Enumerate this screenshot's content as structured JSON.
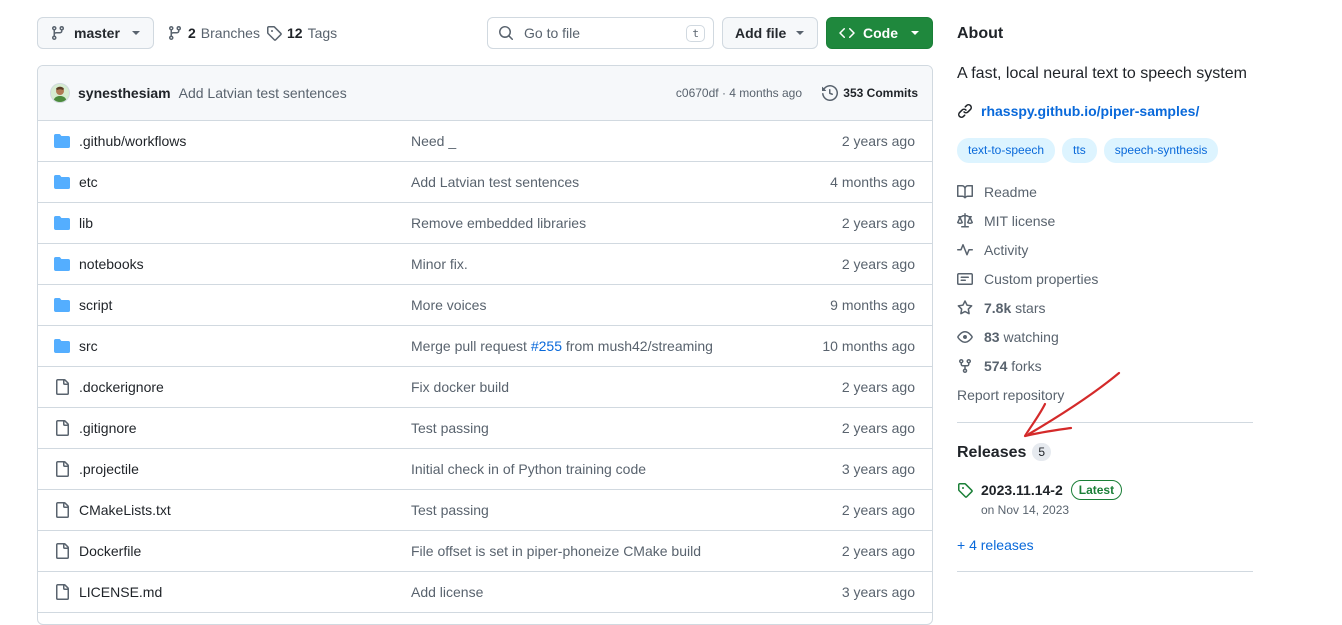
{
  "toolbar": {
    "branch": "master",
    "branches_count": "2",
    "branches_label": "Branches",
    "tags_count": "12",
    "tags_label": "Tags",
    "search_placeholder": "Go to file",
    "search_shortcut": "t",
    "add_file_label": "Add file",
    "code_label": "Code"
  },
  "latest_commit": {
    "author": "synesthesiam",
    "message": "Add Latvian test sentences",
    "meta": "c0670df · 4 months ago",
    "commits_count": "353 Commits"
  },
  "files": [
    {
      "name": ".github/workflows",
      "type": "folder",
      "message": "Need _",
      "date": "2 years ago"
    },
    {
      "name": "etc",
      "type": "folder",
      "message": "Add Latvian test sentences",
      "date": "4 months ago"
    },
    {
      "name": "lib",
      "type": "folder",
      "message": "Remove embedded libraries",
      "date": "2 years ago"
    },
    {
      "name": "notebooks",
      "type": "folder",
      "message": "Minor fix.",
      "date": "2 years ago"
    },
    {
      "name": "script",
      "type": "folder",
      "message": "More voices",
      "date": "9 months ago"
    },
    {
      "name": "src",
      "type": "folder",
      "message_pre": "Merge pull request ",
      "message_pr": "#255",
      "message_post": " from mush42/streaming",
      "date": "10 months ago"
    },
    {
      "name": ".dockerignore",
      "type": "file",
      "message": "Fix docker build",
      "date": "2 years ago"
    },
    {
      "name": ".gitignore",
      "type": "file",
      "message": "Test passing",
      "date": "2 years ago"
    },
    {
      "name": ".projectile",
      "type": "file",
      "message": "Initial check in of Python training code",
      "date": "3 years ago"
    },
    {
      "name": "CMakeLists.txt",
      "type": "file",
      "message": "Test passing",
      "date": "2 years ago"
    },
    {
      "name": "Dockerfile",
      "type": "file",
      "message": "File offset is set in piper-phoneize CMake build",
      "date": "2 years ago"
    },
    {
      "name": "LICENSE.md",
      "type": "file",
      "message": "Add license",
      "date": "3 years ago"
    }
  ],
  "about": {
    "title": "About",
    "description": "A fast, local neural text to speech system",
    "homepage": "rhasspy.github.io/piper-samples/",
    "topics": [
      "text-to-speech",
      "tts",
      "speech-synthesis"
    ],
    "readme": "Readme",
    "license": "MIT license",
    "activity": "Activity",
    "custom_properties": "Custom properties",
    "stars_count": "7.8k",
    "stars_label": "stars",
    "watching_count": "83",
    "watching_label": "watching",
    "forks_count": "574",
    "forks_label": "forks",
    "report": "Report repository"
  },
  "releases": {
    "title": "Releases",
    "count": "5",
    "latest_name": "2023.11.14-2",
    "latest_badge": "Latest",
    "latest_date": "on Nov 14, 2023",
    "more_link": "+ 4 releases"
  },
  "colors": {
    "accent_link": "#0969da",
    "code_button": "#1f883d",
    "folder_icon": "#54aeff",
    "annotation_arrow": "#d42a2a"
  },
  "icons": {
    "branch": "git-branch-icon",
    "tag": "tag-icon",
    "search": "search-icon",
    "folder": "folder-icon",
    "file": "file-icon",
    "history": "history-icon",
    "link": "link-icon",
    "book": "book-icon",
    "law": "law-icon",
    "pulse": "pulse-icon",
    "note": "note-icon",
    "star": "star-icon",
    "eye": "eye-icon",
    "fork": "repo-forked-icon"
  }
}
